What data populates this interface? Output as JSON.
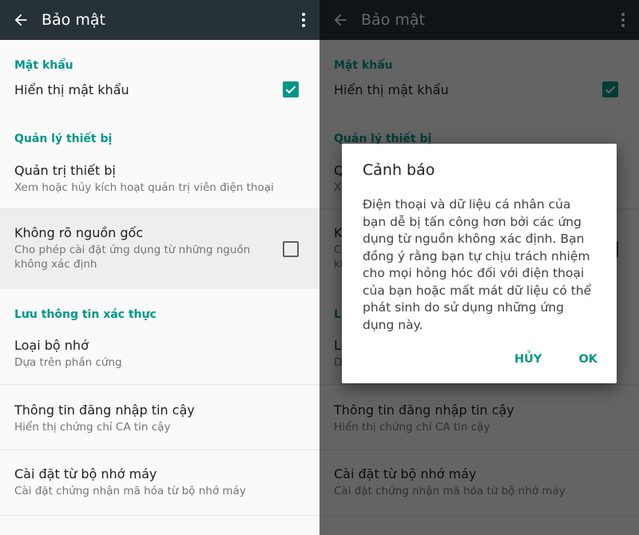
{
  "app": {
    "title": "Bảo mật",
    "back_icon": "arrow-back-icon",
    "more_icon": "more-vert-icon"
  },
  "sections": {
    "password": {
      "header": "Mật khẩu",
      "show_password": {
        "title": "Hiển thị mật khẩu",
        "checked": true
      }
    },
    "device": {
      "header": "Quản lý thiết bị",
      "admin": {
        "title": "Quản trị thiết bị",
        "summary": "Xem hoặc hủy kích hoạt quản trị viên điện thoại"
      },
      "unknown": {
        "title": "Không rõ nguồn gốc",
        "summary": "Cho phép cài đặt ứng dụng từ những nguồn không xác định",
        "checked": false
      }
    },
    "credentials": {
      "header": "Lưu thông tin xác thực",
      "storage": {
        "title": "Loại bộ nhớ",
        "summary": "Dựa trên phần cứng"
      },
      "trusted": {
        "title": "Thông tin đăng nhập tin cậy",
        "summary": "Hiển thị chứng chỉ CA tin cậy"
      },
      "install": {
        "title": "Cài đặt từ bộ nhớ máy",
        "summary": "Cài đặt chứng nhận mã hóa từ bộ nhớ máy"
      }
    }
  },
  "dialog": {
    "title": "Cảnh báo",
    "message": "Điện thoại và dữ liệu cá nhân của bạn dễ bị tấn công hơn bởi các ứng dụng từ nguồn không xác định. Bạn đồng ý rằng bạn tự chịu trách nhiệm cho mọi hỏng hóc đối với điện thoại của bạn hoặc mất mát dữ liệu có thể phát sinh do sử dụng những ứng dụng này.",
    "cancel": "HỦY",
    "ok": "OK"
  },
  "colors": {
    "appbar": "#263238",
    "accent": "#009688"
  }
}
